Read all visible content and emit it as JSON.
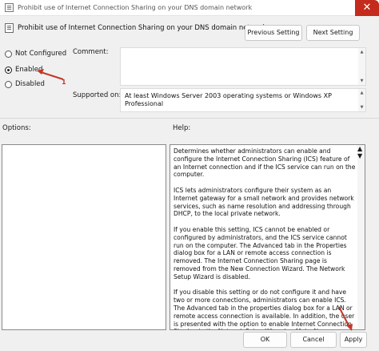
{
  "window": {
    "title": "Prohibit use of Internet Connection Sharing on your DNS domain network",
    "close_glyph": "✕"
  },
  "header": {
    "policy_title": "Prohibit use of Internet Connection Sharing on your DNS domain network",
    "prev_label": "Previous Setting",
    "next_label": "Next Setting"
  },
  "state": {
    "options": [
      {
        "label": "Not Configured",
        "checked": false
      },
      {
        "label": "Enabled",
        "checked": true
      },
      {
        "label": "Disabled",
        "checked": false
      }
    ]
  },
  "fields": {
    "comment_label": "Comment:",
    "comment_value": "",
    "supported_label": "Supported on:",
    "supported_value": "At least Windows Server 2003 operating systems or Windows XP Professional"
  },
  "panes": {
    "options_label": "Options:",
    "help_label": "Help:",
    "help_paragraphs": [
      "Determines whether administrators can enable and configure the Internet Connection Sharing (ICS) feature of an Internet connection and if the ICS service can run on the computer.",
      "ICS lets administrators configure their system as an Internet gateway for a small network and provides network services, such as name resolution and addressing through DHCP, to the local private network.",
      "If you enable this setting, ICS cannot be enabled or configured by administrators, and the ICS service cannot run on the computer. The Advanced tab in the Properties dialog box for a LAN or remote access connection is removed. The Internet Connection Sharing page is removed from the New Connection Wizard. The Network Setup Wizard is disabled.",
      "If you disable this setting or do not configure it and have two or more connections, administrators can enable ICS. The Advanced tab in the properties dialog box for a LAN or remote access connection is available. In addition, the user is presented with the option to enable Internet Connection Sharing in the Network Setup Wizard or Make New Connection Wizard. (The Network Setup Wizard is available only in Windows XP Professional.)"
    ]
  },
  "footer": {
    "ok_label": "OK",
    "cancel_label": "Cancel",
    "apply_label": "Apply"
  },
  "annotations": {
    "badge": "1",
    "color": "#c0392b"
  },
  "icons": {
    "window_icon": "policy-document-icon",
    "close_icon": "close-icon",
    "scroll_up": "▲",
    "scroll_down": "▼"
  }
}
